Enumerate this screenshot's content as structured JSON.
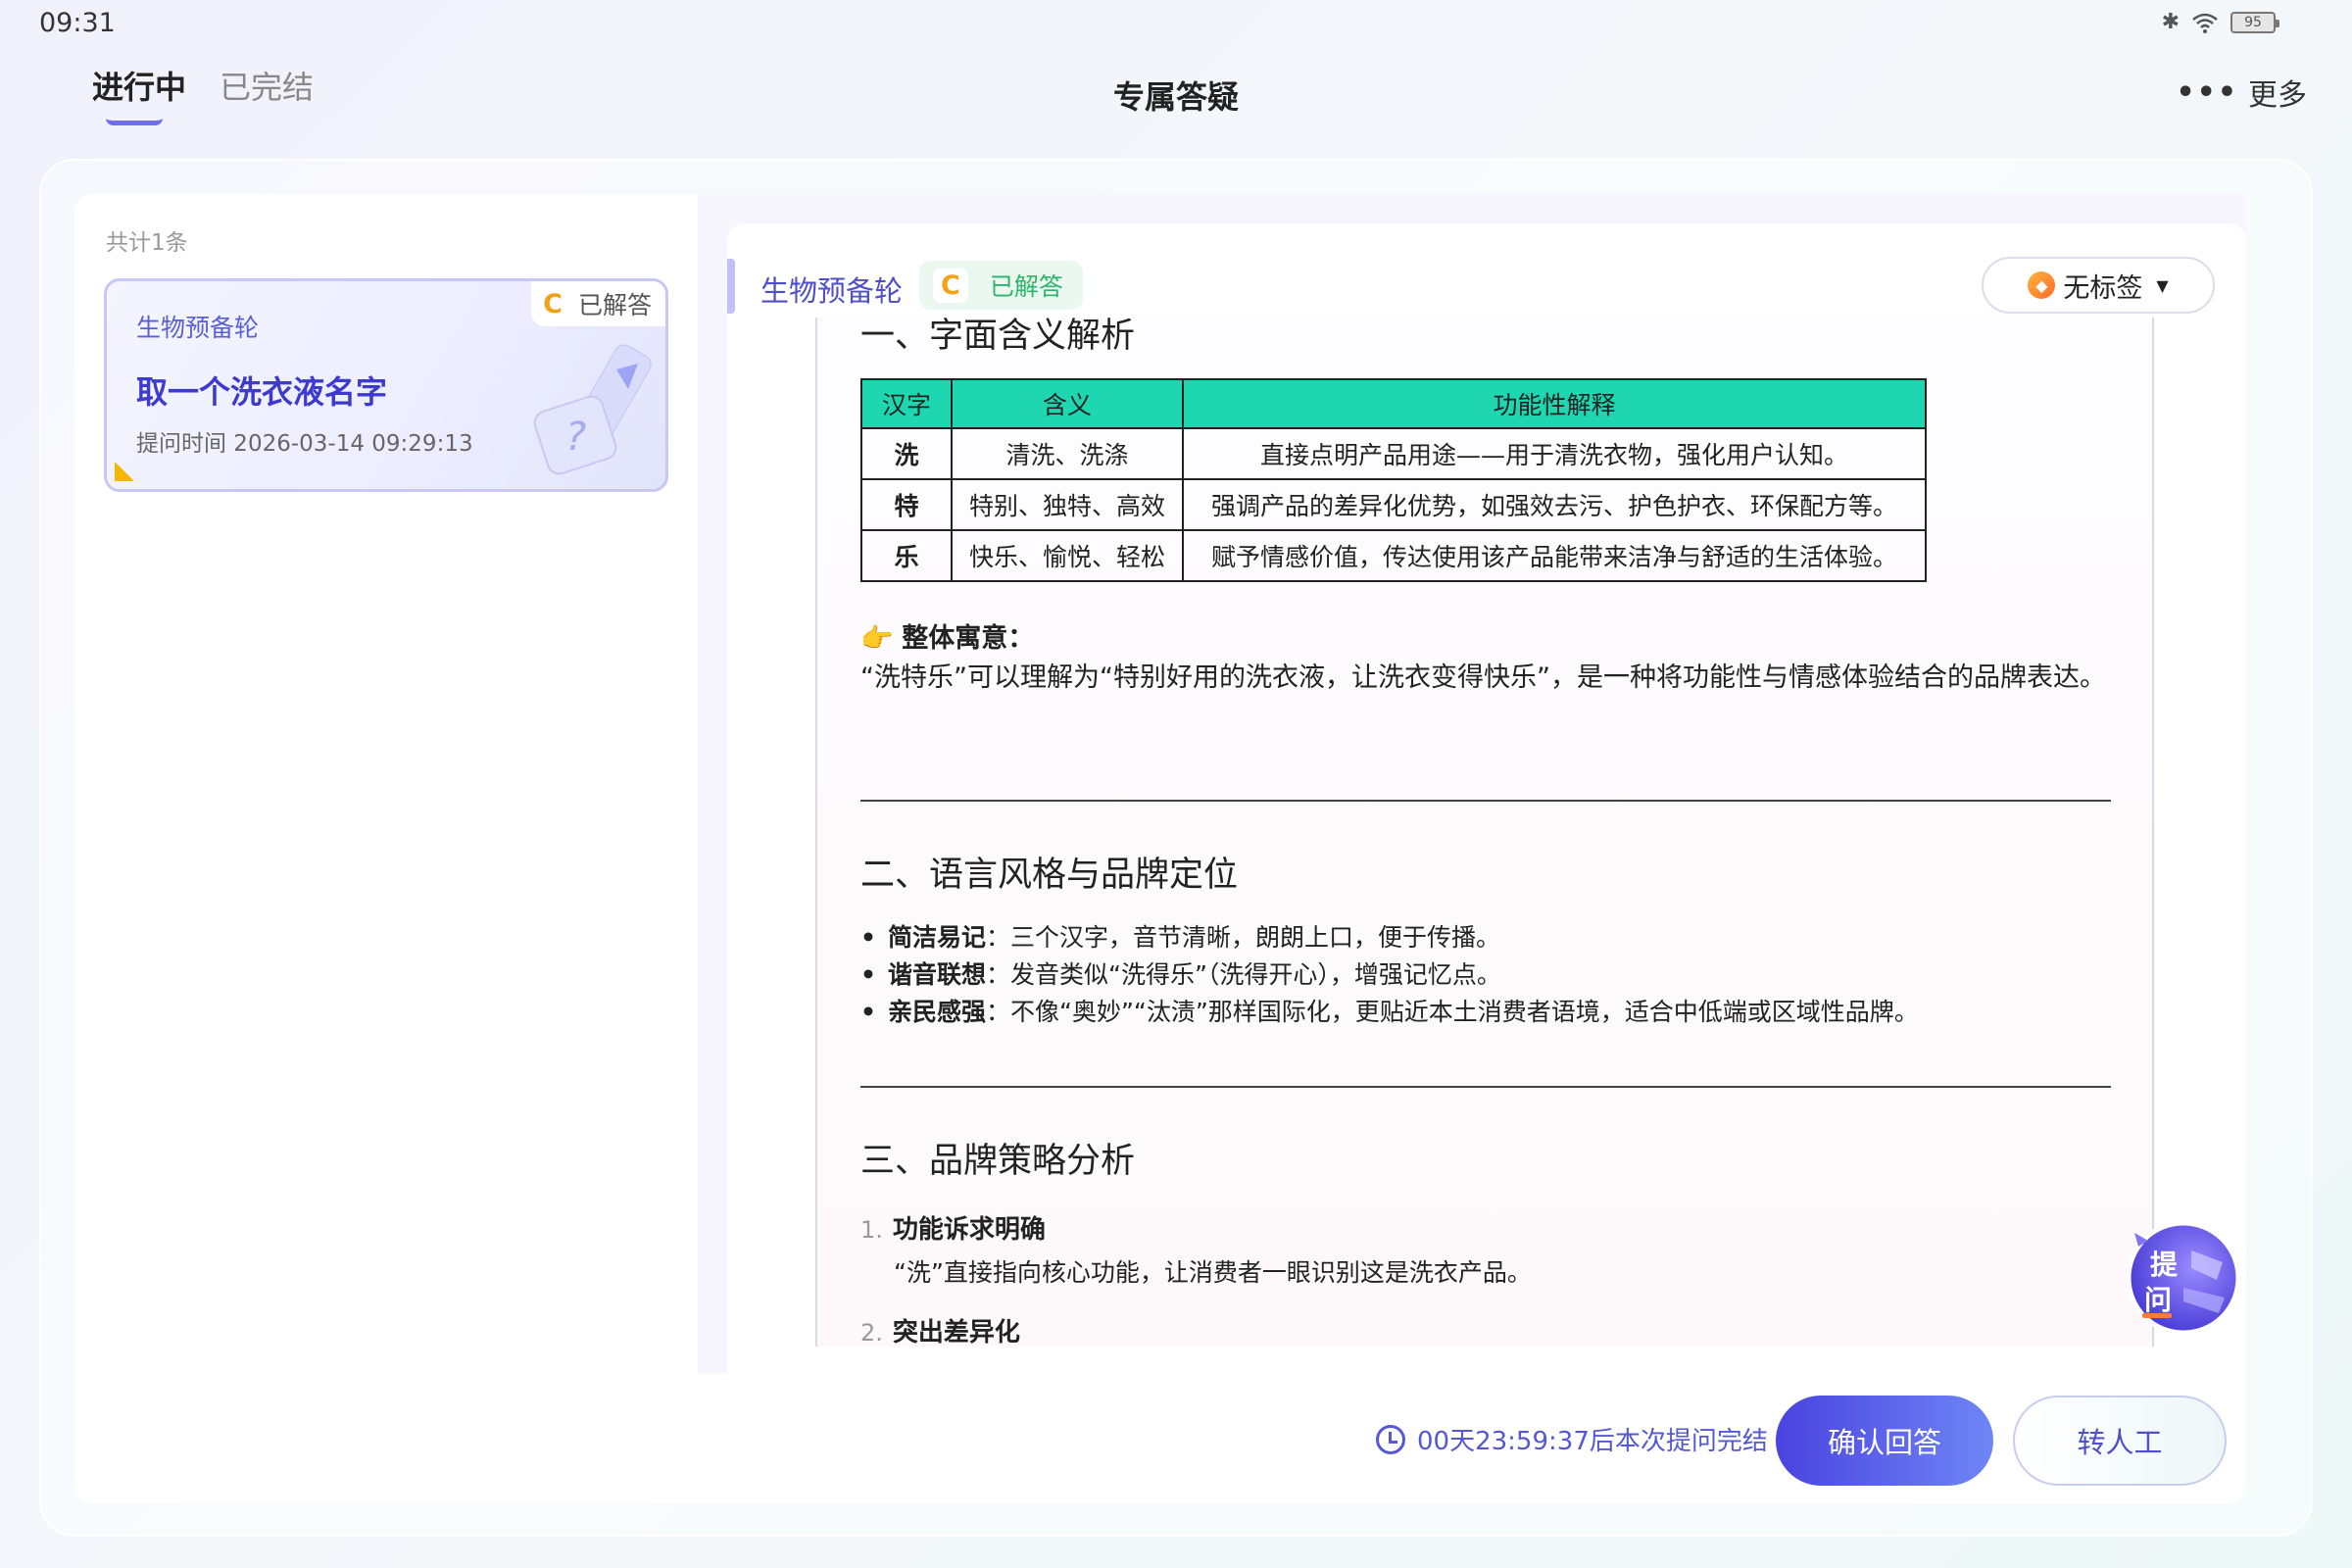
{
  "status_bar": {
    "time": "09:31",
    "battery": "95"
  },
  "header": {
    "tabs": [
      {
        "label": "进行中"
      },
      {
        "label": "已完结"
      }
    ],
    "title": "专属答疑",
    "more_label": "更多"
  },
  "sidebar": {
    "count_label": "共计1条",
    "card": {
      "category": "生物预备轮",
      "badge_icon": "C",
      "status": "已解答",
      "title": "取一个洗衣液名字",
      "time": "提问时间 2026-03-14 09:29:13"
    }
  },
  "detail": {
    "category": "生物预备轮",
    "badge_icon": "C",
    "status": "已解答",
    "tag_label": "无标签"
  },
  "answer": {
    "section1_title": "一、字面含义解析",
    "table": {
      "headers": [
        "汉字",
        "含义",
        "功能性解释"
      ],
      "rows": [
        [
          "洗",
          "清洗、洗涤",
          "直接点明产品用途——用于清洗衣物，强化用户认知。"
        ],
        [
          "特",
          "特别、独特、高效",
          "强调产品的差异化优势，如强效去污、护色护衣、环保配方等。"
        ],
        [
          "乐",
          "快乐、愉悦、轻松",
          "赋予情感价值，传达使用该产品能带来洁净与舒适的生活体验。"
        ]
      ]
    },
    "overall_emoji": "👉",
    "overall_label": "整体寓意",
    "overall_text": "“洗特乐”可以理解为“特别好用的洗衣液，让洗衣变得快乐”，是一种将功能性与情感体验结合的品牌表达。",
    "section2_title": "二、语言风格与品牌定位",
    "points": [
      {
        "label": "简洁易记",
        "text": "：三个汉字，音节清晰，朗朗上口，便于传播。"
      },
      {
        "label": "谐音联想",
        "text": "：发音类似“洗得乐”（洗得开心），增强记忆点。"
      },
      {
        "label": "亲民感强",
        "text": "：不像“奥妙”“汰渍”那样国际化，更贴近本土消费者语境，适合中低端或区域性品牌。"
      }
    ],
    "section3_title": "三、品牌策略分析",
    "strategies": [
      {
        "num": "1.",
        "title": "功能诉求明确",
        "desc": "“洗”直接指向核心功能，让消费者一眼识别这是洗衣产品。"
      },
      {
        "num": "2.",
        "title": "突出差异化",
        "desc": ""
      }
    ]
  },
  "fab": {
    "label_top": "提",
    "label_bottom": "问"
  },
  "footer": {
    "countdown": "00天23:59:37后本次提问完结",
    "confirm_label": "确认回答",
    "human_label": "转人工"
  },
  "colors": {
    "accent": "#4f4fc9",
    "table_header": "#1ed7b1",
    "status_green": "#2fb56a",
    "badge_orange": "#f0a31a"
  }
}
